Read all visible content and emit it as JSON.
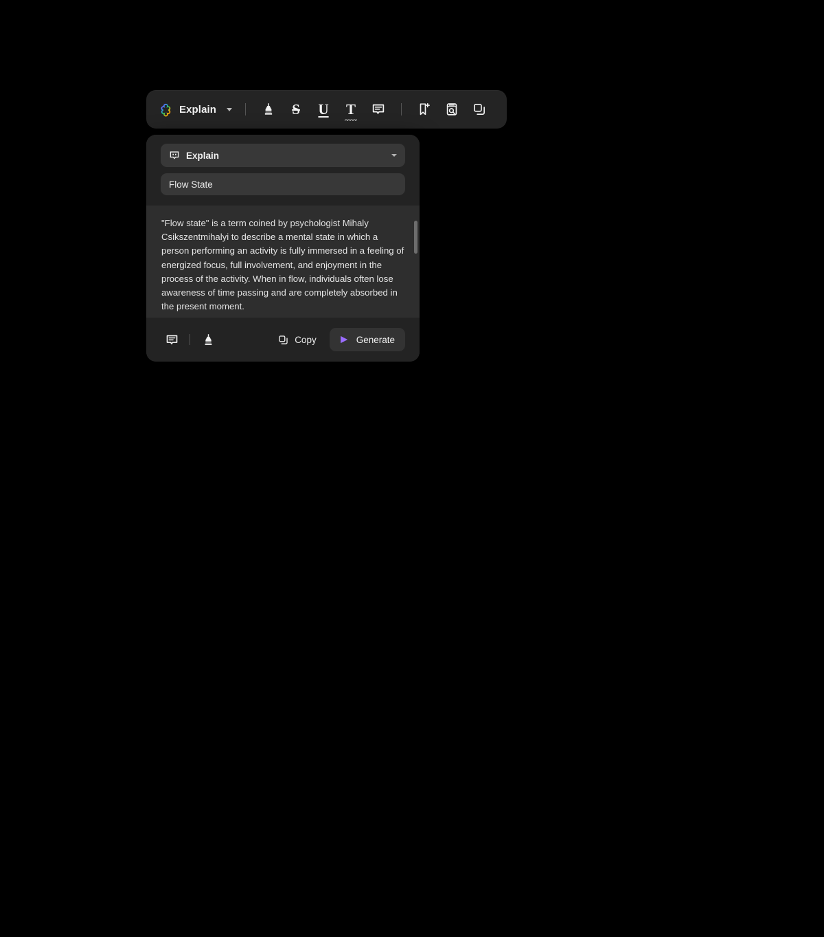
{
  "toolbar": {
    "brand": {
      "label": "Explain",
      "logo_icon": "clover-logo-icon",
      "caret_icon": "chevron-down-icon"
    },
    "items": [
      {
        "name": "highlight-button",
        "icon": "highlighter-icon",
        "label": ""
      },
      {
        "name": "strikethrough-button",
        "icon": "strikethrough-icon",
        "label": "S"
      },
      {
        "name": "underline-button",
        "icon": "underline-icon",
        "label": "U"
      },
      {
        "name": "text-format-button",
        "icon": "spelling-t-icon",
        "label": "T"
      },
      {
        "name": "comment-button",
        "icon": "comment-icon",
        "label": ""
      },
      {
        "name": "bookmark-add-button",
        "icon": "bookmark-add-icon",
        "label": ""
      },
      {
        "name": "search-document-button",
        "icon": "book-search-icon",
        "label": ""
      },
      {
        "name": "copy-button",
        "icon": "copy-icon",
        "label": ""
      }
    ]
  },
  "panel": {
    "mode": {
      "icon": "comment-dots-icon",
      "value": "Explain",
      "caret_icon": "chevron-down-icon",
      "options": [
        "Explain"
      ]
    },
    "topic": {
      "value": "Flow State",
      "placeholder": "Flow State"
    },
    "result": {
      "text": "\"Flow state\" is a term coined by psychologist Mihaly Csikszentmihalyi to describe a mental state in which a person performing an activity is fully immersed in a feeling of energized focus, full involvement, and enjoyment in the process of the activity. When in flow, individuals often lose awareness of time passing and are completely absorbed in the present moment."
    },
    "footer": {
      "comment_icon": "comment-icon",
      "highlight_icon": "highlighter-icon",
      "copy_label": "Copy",
      "copy_icon": "copy-icon",
      "generate_label": "Generate",
      "generate_icon": "play-triangle-icon"
    }
  },
  "colors": {
    "page_background": "#000000",
    "toolbar_background": "#242424",
    "panel_background": "#232323",
    "field_background": "#383838",
    "result_background": "#2e2e2e",
    "accent_purple": "#9b6dff",
    "text_primary": "#f1f1f1",
    "text_body": "#e4e4e4"
  }
}
